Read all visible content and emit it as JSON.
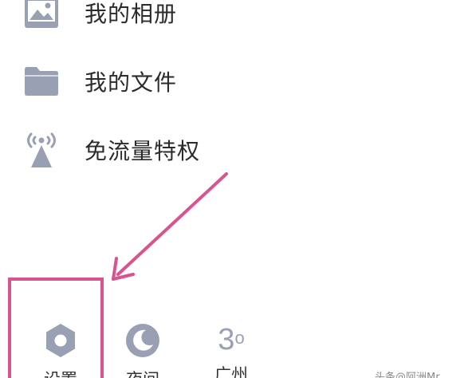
{
  "menu": {
    "items": [
      {
        "label": "我的相册",
        "icon": "photo-album-icon"
      },
      {
        "label": "我的文件",
        "icon": "folder-icon"
      },
      {
        "label": "免流量特权",
        "icon": "signal-tower-icon"
      }
    ]
  },
  "bottom_bar": {
    "settings_label": "设置",
    "night_label": "夜间",
    "weather_temp": "3",
    "weather_unit": "o",
    "weather_city": "广州"
  },
  "watermark": "头条@阿洲Mr",
  "colors": {
    "icon_gray": "#9aa0b4",
    "annotation": "#d9548f",
    "text": "#2b2b2b"
  }
}
